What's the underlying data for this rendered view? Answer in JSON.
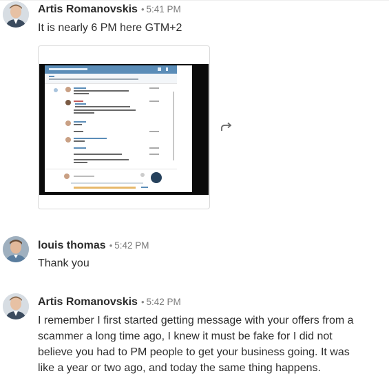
{
  "messages": [
    {
      "author": "Artis Romanovskis",
      "time": "5:41 PM",
      "text": "It is nearly 6 PM here GTM+2",
      "has_attachment": true
    },
    {
      "author": "louis thomas",
      "time": "5:42 PM",
      "text": "Thank you"
    },
    {
      "author": "Artis Romanovskis",
      "time": "5:42 PM",
      "lines": [
        "I remember I first started getting message with your offers from a",
        "scammer a long time ago, I knew it must be fake for I did not",
        "believe you had to PM people to get your business going. It was",
        "like a year or two ago, and today the same thing happens."
      ]
    }
  ],
  "separator": "•",
  "icons": {
    "share": "share-arrow-icon"
  },
  "colors": {
    "bg": "#ffffff",
    "name": "#2b2b2b",
    "time": "#7a7a7a",
    "screenshot_header": "#5b8db8"
  }
}
